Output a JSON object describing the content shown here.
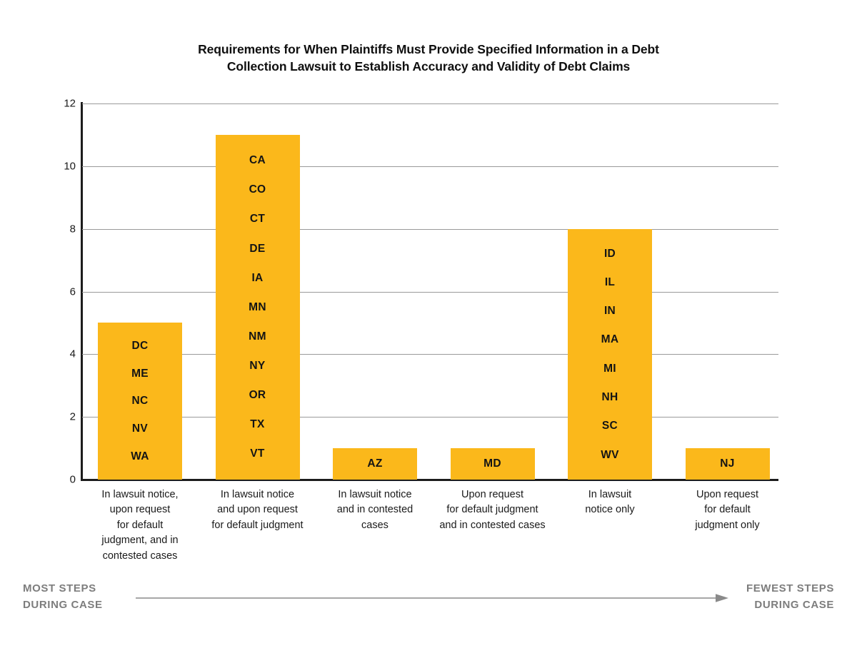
{
  "chart_data": {
    "type": "bar",
    "title": "Requirements for When Plaintiffs Must Provide Specified Information in a Debt Collection Lawsuit to Establish Accuracy and Validity of Debt Claims",
    "title_lines": [
      "Requirements for When Plaintiffs Must Provide Specified Information in a Debt",
      "Collection Lawsuit to Establish Accuracy and Validity of Debt Claims"
    ],
    "xlabel": "",
    "ylabel": "",
    "ylim": [
      0,
      12
    ],
    "yticks": [
      0,
      2,
      4,
      6,
      8,
      10,
      12
    ],
    "ytick_labels": [
      "0",
      "2",
      "4",
      "6",
      "8",
      "10",
      "12"
    ],
    "grid": true,
    "legend": false,
    "bar_color": "#FBB81B",
    "categories": [
      "In lawsuit notice, upon request for default judgment, and in contested cases",
      "In lawsuit notice and upon request for default judgment",
      "In lawsuit notice and in contested cases",
      "Upon request for default judgment and in contested cases",
      "In lawsuit notice only",
      "Upon request for default judgment only"
    ],
    "category_label_lines": [
      [
        "In lawsuit notice,",
        "upon request",
        "for default",
        "judgment, and in",
        "contested cases"
      ],
      [
        "In lawsuit notice",
        "and upon request",
        "for default judgment"
      ],
      [
        "In lawsuit notice",
        "and in contested",
        "cases"
      ],
      [
        "Upon request",
        "for default judgment",
        "and in contested cases"
      ],
      [
        "In lawsuit",
        "notice only"
      ],
      [
        "Upon request",
        "for default",
        "judgment only"
      ]
    ],
    "values": [
      5,
      11,
      1,
      1,
      8,
      1
    ],
    "point_labels": [
      [
        "DC",
        "ME",
        "NC",
        "NV",
        "WA"
      ],
      [
        "CA",
        "CO",
        "CT",
        "DE",
        "IA",
        "MN",
        "NM",
        "NY",
        "OR",
        "TX",
        "VT"
      ],
      [
        "AZ"
      ],
      [
        "MD"
      ],
      [
        "ID",
        "IL",
        "IN",
        "MA",
        "MI",
        "NH",
        "SC",
        "WV"
      ],
      [
        "NJ"
      ]
    ],
    "annotations": {
      "left_label_lines": [
        "MOST STEPS",
        "DURING CASE"
      ],
      "right_label_lines": [
        "FEWEST STEPS",
        "DURING CASE"
      ],
      "arrow_direction": "left-to-right",
      "annotation_color": "#7d7d7d"
    }
  }
}
